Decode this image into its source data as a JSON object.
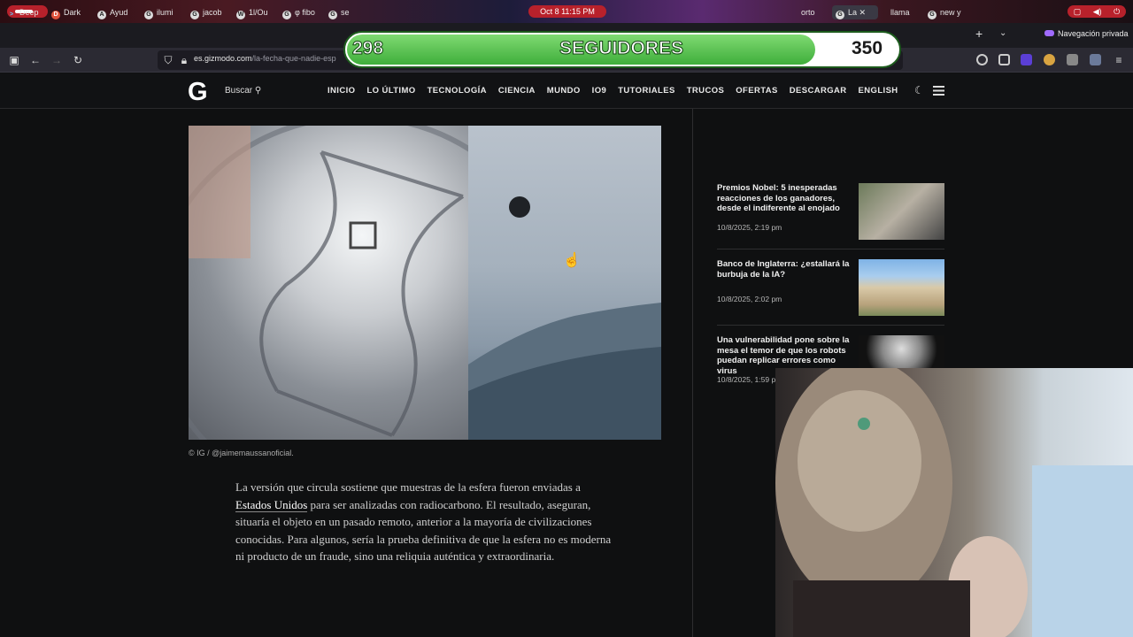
{
  "os": {
    "clock": "Oct 8  11:15 PM"
  },
  "tabs": [
    {
      "label": "Deep",
      "favicon": ">"
    },
    {
      "label": "Dark",
      "favicon": "D"
    },
    {
      "label": "Ayud",
      "favicon": "A"
    },
    {
      "label": "ilumi",
      "favicon": "G"
    },
    {
      "label": "jacob",
      "favicon": "G"
    },
    {
      "label": "1l/Ou",
      "favicon": "W"
    },
    {
      "label": "φ fibo",
      "favicon": "G"
    },
    {
      "label": "se",
      "favicon": "G"
    },
    {
      "label": "orto",
      "favicon": ""
    },
    {
      "label": "La",
      "favicon": "G"
    },
    {
      "label": "llama",
      "favicon": ""
    },
    {
      "label": "new y",
      "favicon": "G"
    }
  ],
  "browser": {
    "new_tab_symbol": "+",
    "tab_list_symbol": "⌄",
    "private_label": "Navegación privada",
    "url_domain": "es.gizmodo.com",
    "url_path": "/la-fecha-que-nadie-esp"
  },
  "overlay": {
    "current": "298",
    "label": "SEGUIDORES",
    "goal": "350",
    "progress": 0.851
  },
  "site": {
    "logo": "G",
    "search_label": "Buscar",
    "nav": [
      "INICIO",
      "LO ÚLTIMO",
      "TECNOLOGÍA",
      "CIENCIA",
      "MUNDO",
      "IO9",
      "TUTORIALES",
      "TRUCOS",
      "OFERTAS",
      "DESCARGAR",
      "ENGLISH"
    ]
  },
  "article": {
    "caption": "© IG / @jaimemaussanoficial.",
    "para_before_link": "La versión que circula sostiene que muestras de la esfera fueron enviadas a ",
    "link_text": "Estados Unidos",
    "para_after_link": " para ser analizadas con radiocarbono. El resultado, aseguran, situaría el objeto en un pasado remoto, anterior a la mayoría de civilizaciones conocidas. Para algunos, sería la prueba definitiva de que la esfera no es moderna ni producto de un fraude, sino una reliquia auténtica y extraordinaria."
  },
  "sidebar": [
    {
      "title": "Premios Nobel: 5 inesperadas reacciones de los ganadores, desde el indiferente al enojado",
      "date": "10/8/2025, 2:19 pm"
    },
    {
      "title": "Banco de Inglaterra: ¿estallará la burbuja de la IA?",
      "date": "10/8/2025, 2:02 pm"
    },
    {
      "title": "Una vulnerabilidad pone sobre la mesa el temor de que los robots puedan replicar errores como virus",
      "date": "10/8/2025, 1:59 pm"
    }
  ]
}
